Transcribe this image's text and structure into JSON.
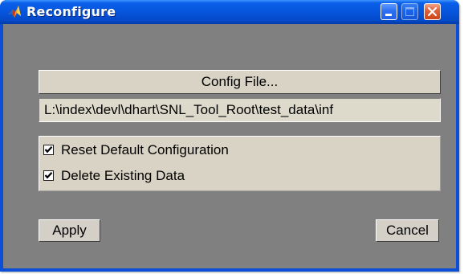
{
  "window": {
    "title": "Reconfigure",
    "app_icon": "matlab-icon",
    "controls": {
      "minimize_icon": "minimize-icon",
      "maximize_icon": "maximize-icon",
      "close_icon": "close-icon"
    }
  },
  "config": {
    "button_label": "Config File...",
    "path_value": "L:\\index\\devl\\dhart\\SNL_Tool_Root\\test_data\\inf"
  },
  "options": [
    {
      "label": "Reset Default Configuration",
      "checked": true
    },
    {
      "label": "Delete Existing Data",
      "checked": true
    }
  ],
  "actions": {
    "apply_label": "Apply",
    "cancel_label": "Cancel"
  },
  "colors": {
    "titlebar": "#0655dd",
    "client_background": "#808080",
    "control_face": "#d8d3c4"
  }
}
